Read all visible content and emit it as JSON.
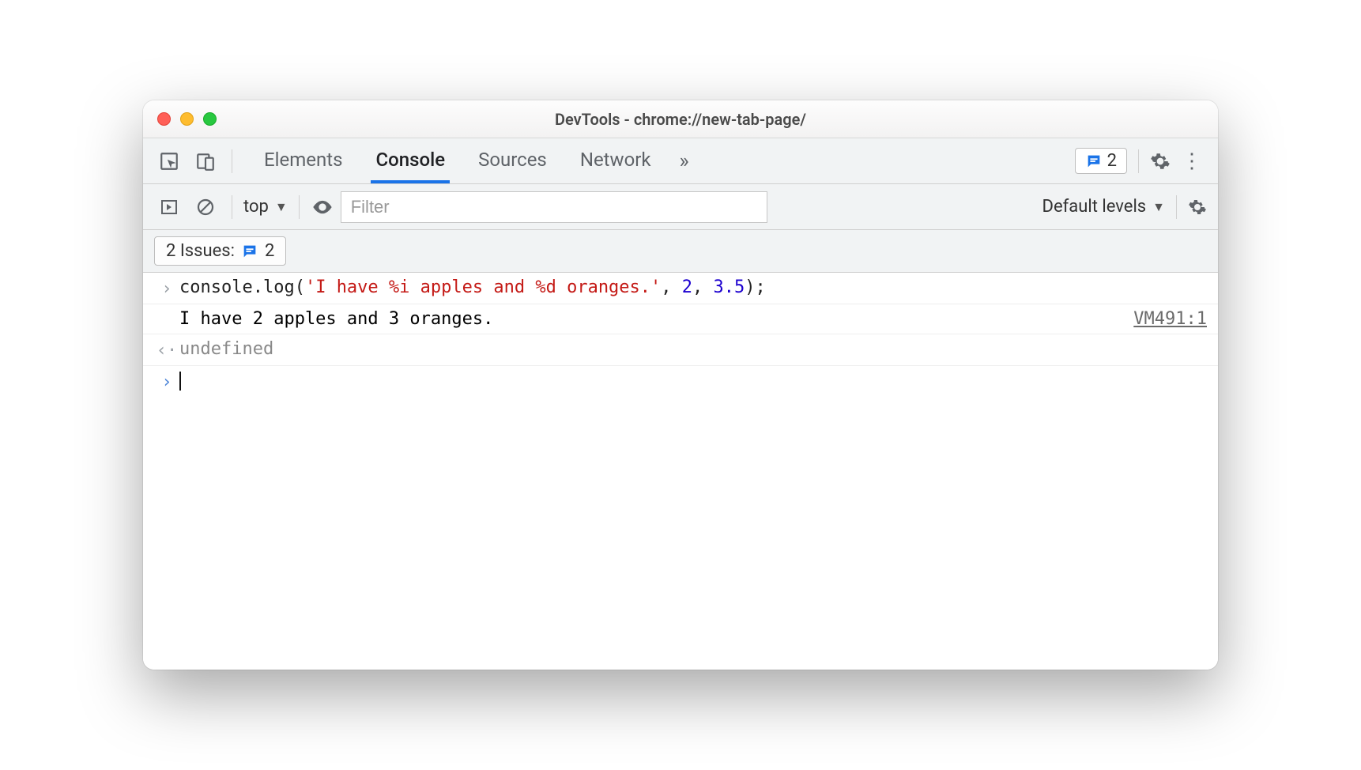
{
  "window": {
    "title": "DevTools - chrome://new-tab-page/"
  },
  "tabs": {
    "elements": "Elements",
    "console": "Console",
    "sources": "Sources",
    "network": "Network",
    "active": "Console"
  },
  "issues_pill": {
    "count": "2"
  },
  "toolbar": {
    "context": "top",
    "filter_placeholder": "Filter",
    "levels_label": "Default levels"
  },
  "issues_row": {
    "label": "2 Issues:",
    "count": "2"
  },
  "console": {
    "input_prefix": "console.log(",
    "input_string": "'I have %i apples and %d oranges.'",
    "input_sep1": ", ",
    "input_arg1": "2",
    "input_sep2": ", ",
    "input_arg2": "3.5",
    "input_suffix": ");",
    "output_text": "I have 2 apples and 3 oranges.",
    "output_source": "VM491:1",
    "return_value": "undefined"
  }
}
